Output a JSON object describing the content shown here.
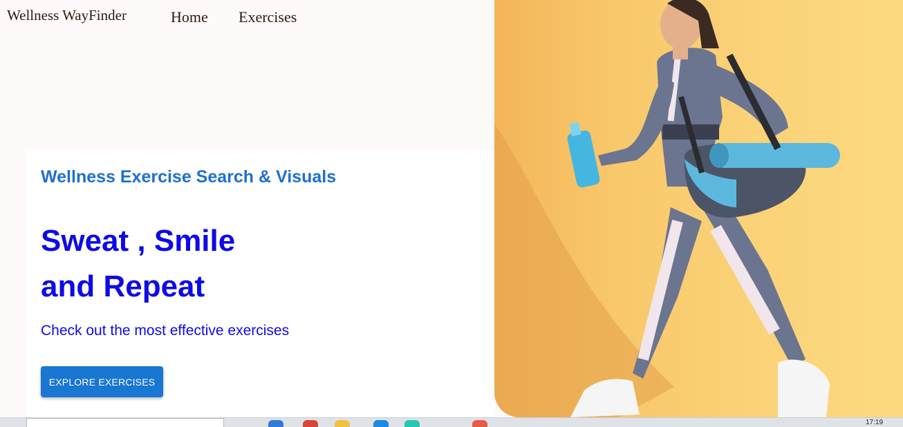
{
  "nav": {
    "brand": "Wellness WayFinder",
    "links": [
      {
        "label": "Home"
      },
      {
        "label": "Exercises"
      }
    ]
  },
  "hero": {
    "subtitle": "Wellness Exercise Search & Visuals",
    "title_line1": "Sweat , Smile",
    "title_line2": "and Repeat",
    "description": "Check out the most effective exercises",
    "cta_label": "EXPLORE EXERCISES"
  },
  "photo": {
    "icon": "woman-walking-with-yoga-mat-photo"
  },
  "taskbar": {
    "clock": "17:19"
  },
  "colors": {
    "accent": "#1976d2",
    "headline": "#0d0be6",
    "subtitle": "#1f6fd1",
    "photo_bg": "#f9cc72"
  }
}
